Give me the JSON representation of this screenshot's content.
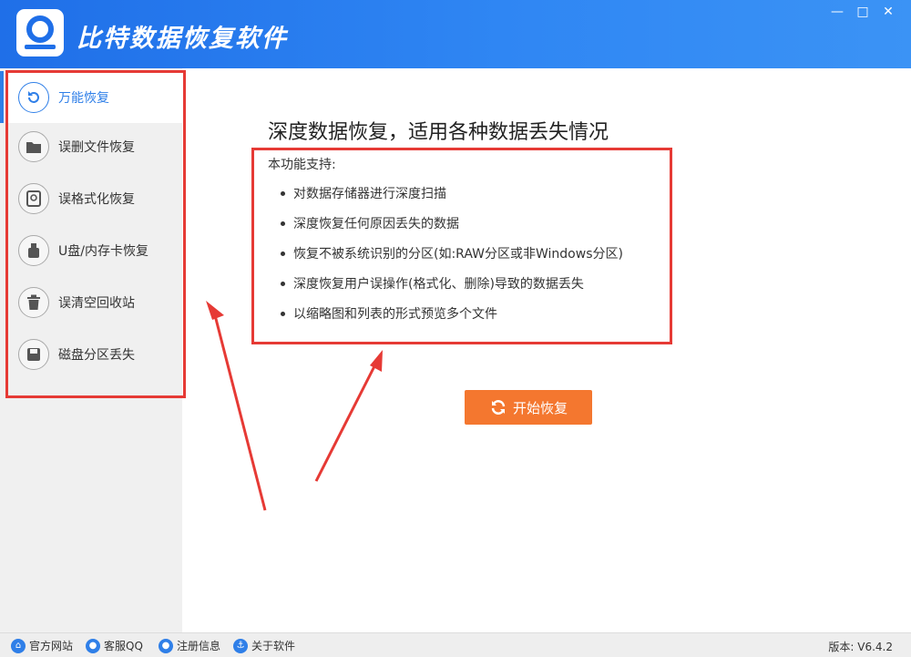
{
  "app": {
    "title": "比特数据恢复软件"
  },
  "window_controls": {
    "minimize": "—",
    "maximize": "□",
    "close": "✕"
  },
  "sidebar": {
    "items": [
      {
        "label": "万能恢复",
        "icon": "undo-icon",
        "active": true
      },
      {
        "label": "误删文件恢复",
        "icon": "folder-icon"
      },
      {
        "label": "误格式化恢复",
        "icon": "disk-icon"
      },
      {
        "label": "U盘/内存卡恢复",
        "icon": "usb-icon"
      },
      {
        "label": "误清空回收站",
        "icon": "trash-icon"
      },
      {
        "label": "磁盘分区丢失",
        "icon": "save-icon"
      }
    ]
  },
  "main": {
    "heading": "深度数据恢复，适用各种数据丢失情况",
    "support_title": "本功能支持:",
    "features": [
      "对数据存储器进行深度扫描",
      "深度恢复任何原因丢失的数据",
      "恢复不被系统识别的分区(如:RAW分区或非Windows分区)",
      "深度恢复用户误操作(格式化、删除)导致的数据丢失",
      "以缩略图和列表的形式预览多个文件"
    ],
    "start_button": "开始恢复"
  },
  "footer": {
    "links": [
      {
        "label": "官方网站",
        "icon": "home-icon"
      },
      {
        "label": "客服QQ",
        "icon": "qq-icon"
      },
      {
        "label": "注册信息",
        "icon": "user-icon"
      },
      {
        "label": "关于软件",
        "icon": "info-icon"
      }
    ],
    "version": "版本: V6.4.2"
  },
  "colors": {
    "accent": "#2f7fe8",
    "titlebar": "#1f6fe8",
    "button": "#f4772f",
    "annotation": "#e63a35"
  }
}
